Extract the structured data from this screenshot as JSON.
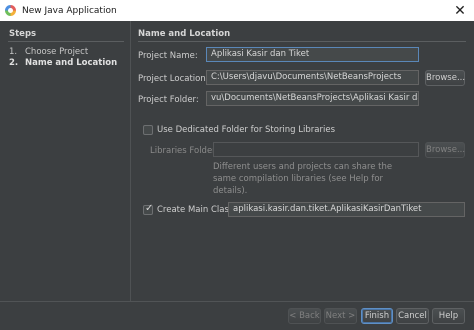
{
  "window": {
    "title": "New Java Application",
    "close_glyph": "✕"
  },
  "steps": {
    "header": "Steps",
    "items": [
      {
        "num": "1.",
        "label": "Choose Project",
        "active": false
      },
      {
        "num": "2.",
        "label": "Name and Location",
        "active": true
      }
    ]
  },
  "section": {
    "title": "Name and Location"
  },
  "form": {
    "project_name": {
      "label": "Project Name:",
      "value": "Aplikasi Kasir dan Tiket"
    },
    "project_location": {
      "label": "Project Location:",
      "value": "C:\\Users\\djavu\\Documents\\NetBeansProjects",
      "browse_label": "Browse..."
    },
    "project_folder": {
      "label": "Project Folder:",
      "value": "vu\\Documents\\NetBeansProjects\\Aplikasi Kasir dan Tiket"
    },
    "dedicated_folder": {
      "label": "Use Dedicated Folder for Storing Libraries",
      "checked": false
    },
    "libraries_folder": {
      "label": "Libraries Folder:",
      "value": "",
      "browse_label": "Browse..."
    },
    "libraries_note": "Different users and projects can share the same compilation libraries (see Help for details).",
    "create_main_class": {
      "label": "Create Main Class",
      "checked": true,
      "value": "aplikasi.kasir.dan.tiket.AplikasiKasirDanTiket"
    }
  },
  "buttons": {
    "back": "< Back",
    "next": "Next >",
    "finish": "Finish",
    "cancel": "Cancel",
    "help": "Help"
  },
  "colors": {
    "background": "#3c3f41",
    "field": "#45494a",
    "focus": "#5a87b8",
    "text": "#c8c8c8"
  }
}
